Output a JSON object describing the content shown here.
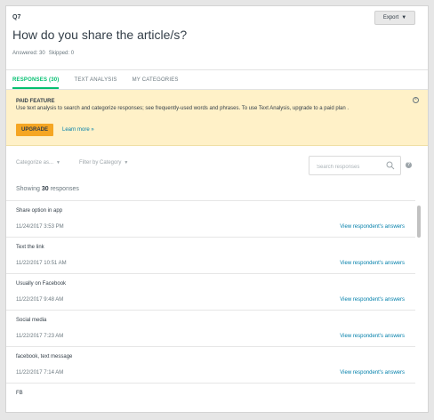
{
  "question": {
    "number": "Q7",
    "title": "How do you share the article/s?",
    "answered": "Answered: 30",
    "skipped": "Skipped: 0"
  },
  "toolbar": {
    "export_label": "Export"
  },
  "tabs": [
    {
      "label": "RESPONSES (30)",
      "active": true
    },
    {
      "label": "TEXT ANALYSIS",
      "active": false
    },
    {
      "label": "MY CATEGORIES",
      "active": false
    }
  ],
  "paid_feature": {
    "title": "PAID FEATURE",
    "text": "Use text analysis to search and categorize responses; see frequently-used words and phrases. To use Text Analysis, upgrade to a paid plan .",
    "upgrade_label": "UPGRADE",
    "learn_more": "Learn more »"
  },
  "filters": {
    "categorize": "Categorize as...",
    "filter_by": "Filter by Category",
    "search_placeholder": "Search responses"
  },
  "showing": {
    "prefix": "Showing",
    "count": "30",
    "suffix": "responses"
  },
  "responses": [
    {
      "text": "Share option in app",
      "date": "11/24/2017 3:53 PM",
      "link": "View respondent's answers"
    },
    {
      "text": "Text the link",
      "date": "11/22/2017 10:51 AM",
      "link": "View respondent's answers"
    },
    {
      "text": "Usually on Facebook",
      "date": "11/22/2017 9:48 AM",
      "link": "View respondent's answers"
    },
    {
      "text": "Social media",
      "date": "11/22/2017 7:23 AM",
      "link": "View respondent's answers"
    },
    {
      "text": "facebook, text message",
      "date": "11/22/2017 7:14 AM",
      "link": "View respondent's answers"
    },
    {
      "text": "FB",
      "date": "",
      "link": ""
    }
  ],
  "colors": {
    "accent": "#00bf6f",
    "link": "#007faa",
    "banner": "#fff1c8",
    "upgrade": "#f5a623"
  }
}
